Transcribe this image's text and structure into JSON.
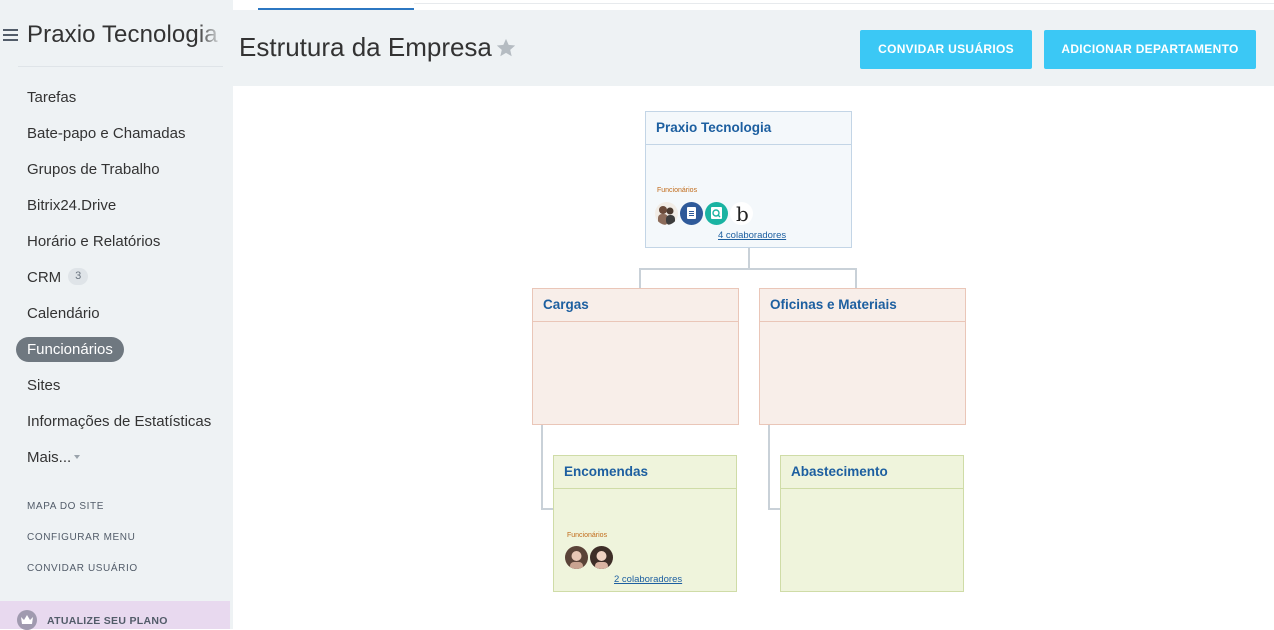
{
  "sidebar": {
    "brand": "Praxio Tecnologia",
    "items": [
      {
        "label": "Tarefas"
      },
      {
        "label": "Bate-papo e Chamadas"
      },
      {
        "label": "Grupos de Trabalho"
      },
      {
        "label": "Bitrix24.Drive"
      },
      {
        "label": "Horário e Relatórios"
      },
      {
        "label": "CRM",
        "counter": "3"
      },
      {
        "label": "Calendário"
      },
      {
        "label": "Funcionários",
        "active": true
      },
      {
        "label": "Sites"
      },
      {
        "label": "Informações de Estatísticas"
      },
      {
        "label": "Mais..."
      }
    ],
    "links": [
      "MAPA DO SITE",
      "CONFIGURAR MENU",
      "CONVIDAR USUÁRIO"
    ],
    "upgrade_label": "ATUALIZE SEU PLANO"
  },
  "header": {
    "title": "Estrutura da Empresa",
    "invite_button": "CONVIDAR USUÁRIOS",
    "add_department_button": "ADICIONAR DEPARTAMENTO"
  },
  "org": {
    "root": {
      "name": "Praxio Tecnologia",
      "employees_label": "Funcionários",
      "collaborators": "4 colaboradores",
      "avatars": [
        "person-avatar-icon",
        "document-icon",
        "search-document-icon",
        "bold-b-icon"
      ]
    },
    "departments": [
      {
        "name": "Cargas"
      },
      {
        "name": "Oficinas e Materiais"
      }
    ],
    "subdepartments": [
      {
        "name": "Encomendas",
        "employees_label": "Funcionários",
        "collaborators": "2 colaboradores"
      },
      {
        "name": "Abastecimento"
      }
    ]
  },
  "colors": {
    "accent_button": "#3bc8f5",
    "link": "#1d5fa0",
    "root_box": "#f4f8fb",
    "dept_box": "#f8eee9",
    "subdept_box": "#eff4dc",
    "active_menu": "#6f7880"
  }
}
